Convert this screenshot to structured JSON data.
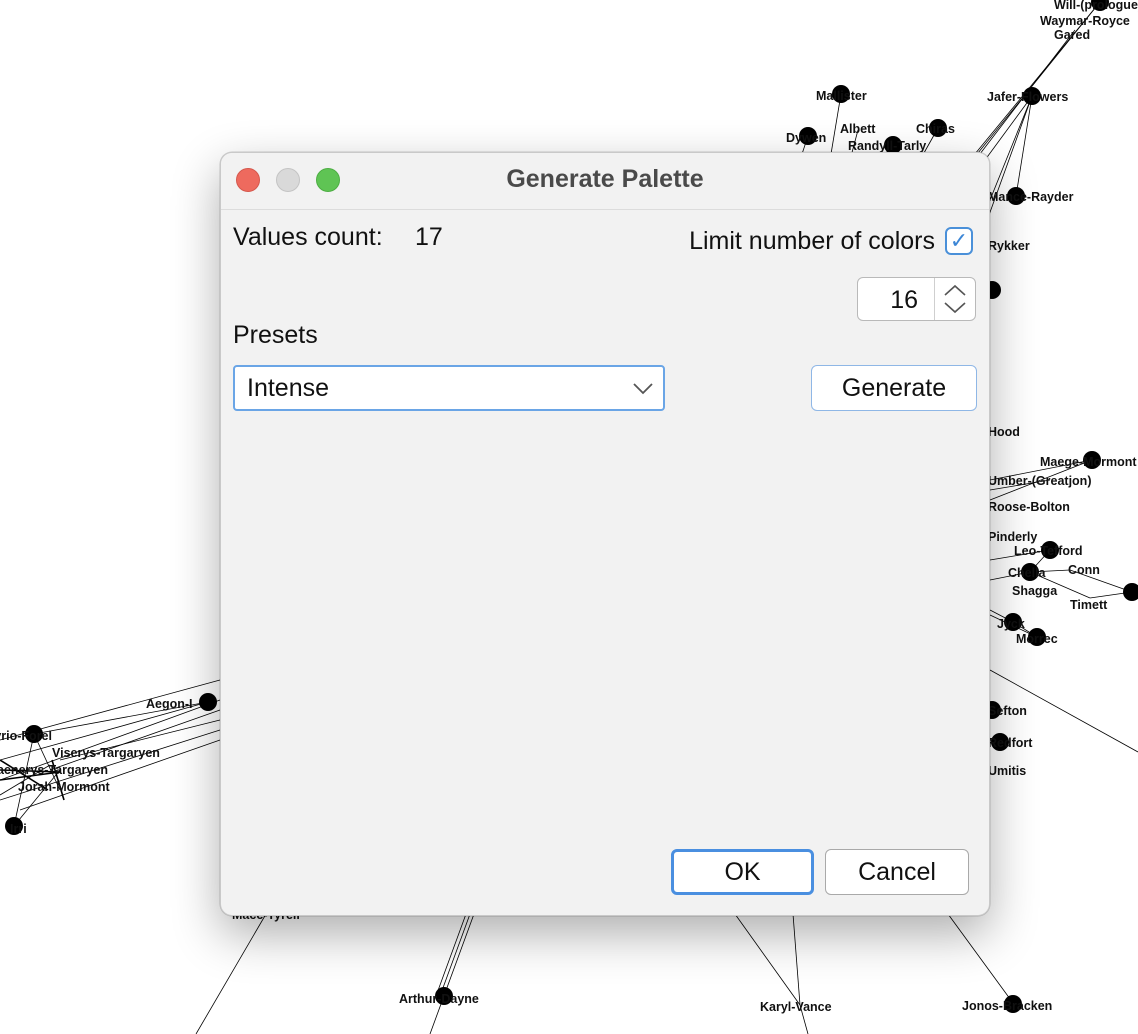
{
  "graph": {
    "labels": {
      "will": "Will-(prologue)",
      "waymar": "Waymar-Royce",
      "gared": "Gared",
      "mallister": "Mallister",
      "jafer": "Jafer-Flowers",
      "albett": "Albett",
      "dywen": "Dywen",
      "chiras": "Chiras",
      "randyll": "Randyll-Tarly",
      "rayder": "Mance-Rayder",
      "rykker": "Rykker",
      "hood": "Hood",
      "maege": "Maege-Mormont",
      "greatjon": "Umber-(Greatjon)",
      "roose": "Roose-Bolton",
      "pinderly": "Pinderly",
      "leo": "Leo-Tefford",
      "conn": "Conn",
      "chella": "Chella",
      "shagga": "Shagga",
      "timett": "Timett",
      "jyck": "Jyck",
      "morrec": "Morrec",
      "sefton": "Sefton",
      "redfort": "Redfort",
      "umitis": "Umitis",
      "aegon": "Aegon-I",
      "syrio": "Syrio-Forel",
      "viserys": "Viserys-Targaryen",
      "daenerys": "Daenerys-Targaryen",
      "jorah": "Jorah-Mormont",
      "irri": "Irri",
      "mace": "Mace-Tyrell",
      "arthur": "Arthur-Dayne",
      "karyl": "Karyl-Vance",
      "jonos": "Jonos-Bracken"
    }
  },
  "dialog": {
    "title": "Generate Palette",
    "values_count_label": "Values count:",
    "values_count": "17",
    "limit_label": "Limit number of colors",
    "limit_checked": true,
    "limit_value": "16",
    "presets_label": "Presets",
    "preset_selected": "Intense",
    "generate_label": "Generate",
    "ok_label": "OK",
    "cancel_label": "Cancel"
  },
  "colors": {
    "close": "#ee6a5e",
    "minimize": "#d9d9d9",
    "maximize": "#5fc454",
    "accent": "#4a90d9"
  }
}
